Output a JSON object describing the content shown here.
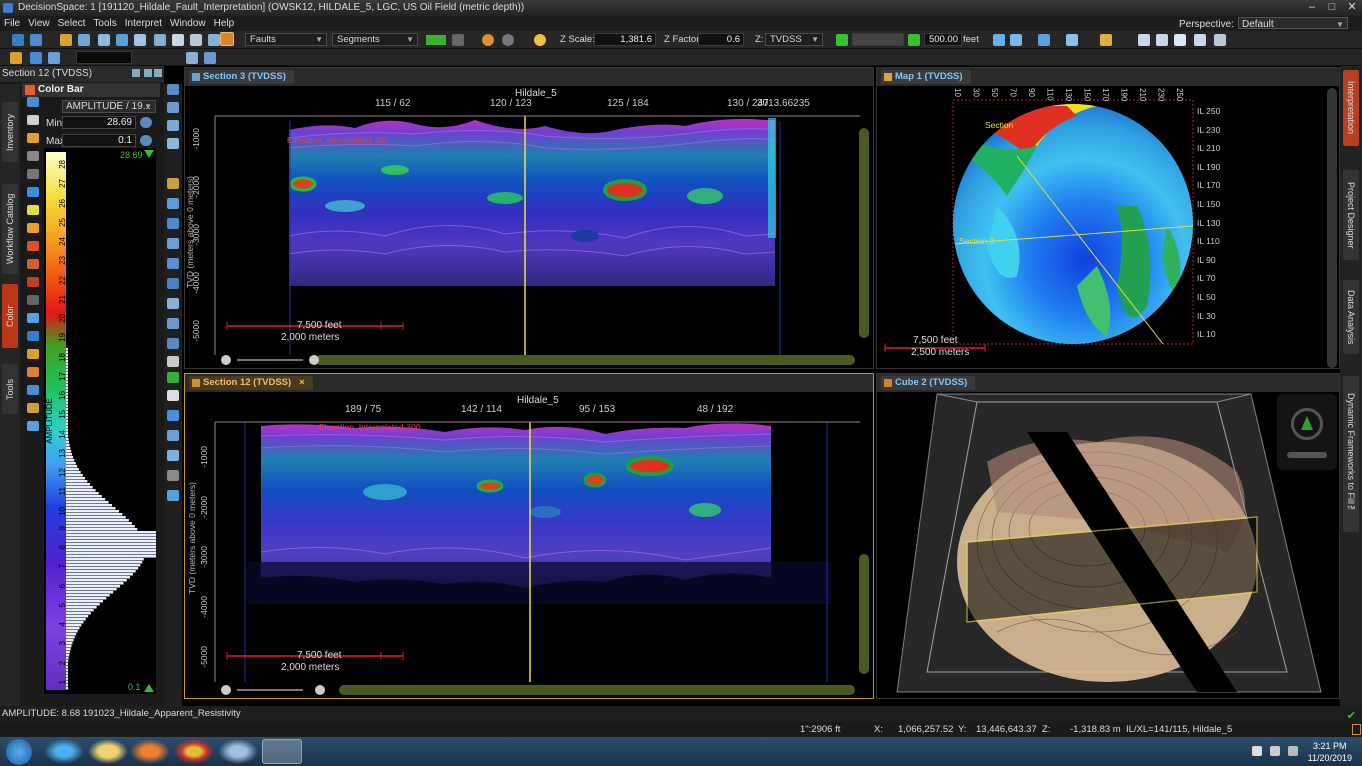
{
  "window": {
    "title": "DecisionSpace: 1 [191120_Hildale_Fault_Interpretation] (OWSK12, HILDALE_5, LGC, US Oil Field (metric depth))",
    "minimize": "–",
    "maximize": "□",
    "close": "✕"
  },
  "menu": {
    "items": [
      "File",
      "View",
      "Select",
      "Tools",
      "Interpret",
      "Window",
      "Help"
    ],
    "perspective_label": "Perspective:",
    "perspective_value": "Default"
  },
  "toolbar": {
    "faults": "Faults",
    "segments": "Segments",
    "zscale_label": "Z Scale:",
    "zscale_value": "1,381.6",
    "zfactor_label": "Z Factor",
    "zfactor_value": "0.6",
    "zdomain_label": "Z:",
    "zdomain_value": "TVDSS",
    "step_value": "500.00",
    "step_unit": "feet"
  },
  "left_panel": {
    "title": "Section 12 (TVDSS)",
    "colorbar_title": "Color Bar",
    "attribute": "AMPLITUDE / 19...",
    "min_label": "Min",
    "min_value": "28.69",
    "max_label": "Max",
    "max_value": "0.1",
    "bar_top_value": "28.69",
    "bar_bottom_value": "0.1",
    "axis_label": "AMPLITUDE",
    "ticks": [
      "28",
      "27",
      "26",
      "25",
      "24",
      "23",
      "22",
      "21",
      "20",
      "19",
      "18",
      "17",
      "16",
      "15",
      "14",
      "13",
      "12",
      "11",
      "10",
      "9",
      "8",
      "7",
      "6",
      "5",
      "4",
      "3",
      "2",
      "1"
    ],
    "vertical_tabs": [
      "Inventory",
      "Workflow Catalog",
      "Color",
      "Tools"
    ]
  },
  "section3": {
    "tab": "Section 3 (TVDSS)",
    "well": "Hildale_5",
    "top_labels": [
      "115 / 62",
      "120 / 123",
      "125 / 184",
      "130 / 247",
      "3013.66235"
    ],
    "depth_ticks": [
      "-1000",
      "-2000",
      "-3000",
      "-4000",
      "-5000"
    ],
    "y_axis_label": "TVD (meters above 0 meters)",
    "horizon": "Elevation_Interpolated-300",
    "scale_feet": "7,500 feet",
    "scale_meters": "2,000 meters"
  },
  "section12": {
    "tab": "Section 12 (TVDSS)",
    "close": "×",
    "well": "Hildale_5",
    "top_labels": [
      "189 / 75",
      "142 / 114",
      "95 / 153",
      "48 / 192"
    ],
    "depth_ticks": [
      "-1000",
      "-2000",
      "-3000",
      "-4000",
      "-5000"
    ],
    "y_axis_label": "TVD (meters above 0 meters)",
    "horizon": "Elevation_Interpolated-300",
    "scale_feet": "7,500 feet",
    "scale_meters": "2,000 meters"
  },
  "map1": {
    "tab": "Map 1 (TVDSS)",
    "top_ticks": [
      "10",
      "30",
      "50",
      "70",
      "90",
      "110",
      "130",
      "150",
      "170",
      "190",
      "210",
      "230",
      "250"
    ],
    "il_ticks": [
      "IL 250",
      "IL 230",
      "IL 210",
      "IL 190",
      "IL 170",
      "IL 150",
      "IL 130",
      "IL 110",
      "IL 90",
      "IL 70",
      "IL 50",
      "IL 30",
      "IL 10"
    ],
    "section_labels": [
      "Section",
      "Section 3"
    ],
    "scale_feet": "7,500 feet",
    "scale_meters": "2,500 meters"
  },
  "cube2": {
    "tab": "Cube 2 (TVDSS)"
  },
  "right_tabs": [
    "Interpretation",
    "Project Designer",
    "Data Analysis",
    "Dynamic Frameworks to Fill™"
  ],
  "status": {
    "text": "AMPLITUDE: 8.68 191023_Hildale_Apparent_Resistivity"
  },
  "coords": {
    "scale": "1\":2906 ft",
    "x_label": "X:",
    "x_value": "1,066,257.52",
    "y_label": "Y:",
    "y_value": "13,446,643.37",
    "z_label": "Z:",
    "z_value": "-1,318.83 m",
    "ilxl": "IL/XL=141/115, Hildale_5"
  },
  "taskbar": {
    "time": "3:21 PM",
    "date": "11/20/2019"
  },
  "colors": {
    "accent": "#c89430",
    "tab_text": "#7ec8ff",
    "taskbar": "#19324a"
  }
}
